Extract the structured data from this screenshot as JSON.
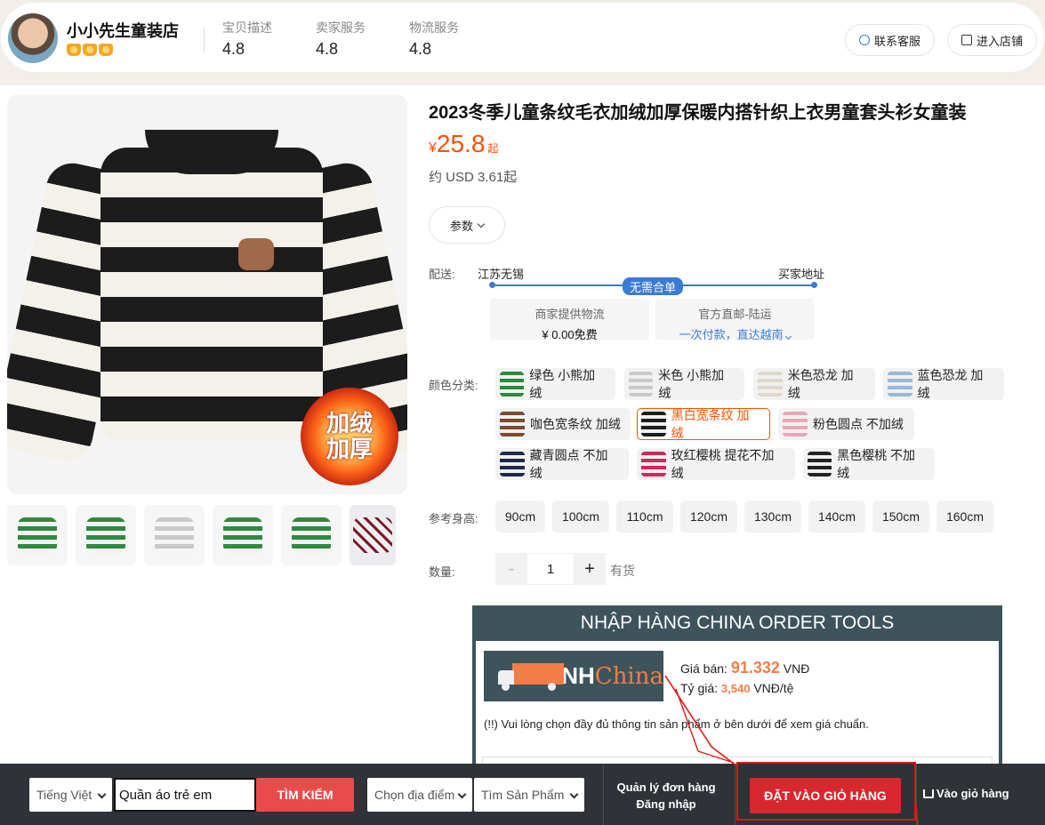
{
  "shop": {
    "name": "小小先生童装店",
    "ratings": [
      {
        "label": "宝贝描述",
        "value": "4.8"
      },
      {
        "label": "卖家服务",
        "value": "4.8"
      },
      {
        "label": "物流服务",
        "value": "4.8"
      }
    ],
    "contact_label": "联系客服",
    "enter_label": "进入店铺"
  },
  "product": {
    "title": "2023冬季儿童条纹毛衣加绒加厚保暖内搭针织上衣男童套头衫女童装",
    "price_currency": "¥",
    "price": "25.8",
    "price_suffix": "起",
    "usd_price": "约 USD 3.61起",
    "params_label": "参数",
    "badge_line1": "加绒",
    "badge_line2": "加厚"
  },
  "shipping": {
    "label": "配送:",
    "from": "江苏无锡",
    "to": "买家地址",
    "tag": "无需合单",
    "option1_title": "商家提供物流",
    "option1_value": "¥ 0.00免费",
    "option2_title": "官方直邮-陆运",
    "option2_value": "一次付款，直达越南"
  },
  "colors": {
    "label": "颜色分类:",
    "options": [
      {
        "label": "绿色 小熊加绒",
        "swatch": "#2e8a3e",
        "selected": false
      },
      {
        "label": "米色 小熊加绒",
        "swatch": "#c9c9c9",
        "selected": false
      },
      {
        "label": "米色恐龙 加绒",
        "swatch": "#e0d8c8",
        "selected": false
      },
      {
        "label": "蓝色恐龙 加绒",
        "swatch": "#9bb8d6",
        "selected": false
      },
      {
        "label": "咖色宽条纹 加绒",
        "swatch": "#7a4a34",
        "selected": false
      },
      {
        "label": "黑白宽条纹 加绒",
        "swatch": "#1c1c1c",
        "selected": true
      },
      {
        "label": "粉色圆点 不加绒",
        "swatch": "#e8a6b8",
        "selected": false
      },
      {
        "label": "藏青圆点 不加绒",
        "swatch": "#1e2a4a",
        "selected": false
      },
      {
        "label": "玫红樱桃 提花不加绒",
        "swatch": "#d0285c",
        "selected": false
      },
      {
        "label": "黑色樱桃 不加绒",
        "swatch": "#222222",
        "selected": false
      }
    ]
  },
  "sizes": {
    "label": "参考身高:",
    "options": [
      "90cm",
      "100cm",
      "110cm",
      "120cm",
      "130cm",
      "140cm",
      "150cm",
      "160cm"
    ]
  },
  "quantity": {
    "label": "数量:",
    "minus": "-",
    "value": "1",
    "plus": "+",
    "stock": "有货"
  },
  "tool": {
    "header": "NHẬP HÀNG CHINA ORDER TOOLS",
    "logo_nh": "NH",
    "logo_china": "China",
    "price_label": "Giá bán:",
    "price_value": "91.332",
    "price_unit": "VNĐ",
    "rate_label": "Tỷ giá:",
    "rate_value": "3,540",
    "rate_unit": "VNĐ/tệ",
    "note": "(!!) Vui lòng chọn đầy đủ thông tin sản phẩm ở bên dưới để xem giá chuẩn."
  },
  "bottom_bar": {
    "language": "Tiếng Việt",
    "search_value": "Quần áo trẻ em",
    "search_button": "TÌM KIẾM",
    "location": "Chọn địa điểm",
    "product_select": "Tìm Sản Phẩm",
    "order_mgmt": "Quản lý đơn hàng",
    "login": "Đăng nhập",
    "add_to_cart": "ĐẶT VÀO GIỎ HÀNG",
    "goto_cart": "Vào giỏ hàng"
  },
  "colors_theme": {
    "accent": "#ff5000",
    "blue": "#3a7bd5",
    "tool_bg": "#3d545c",
    "cart_red": "#d9272e",
    "annotation": "#e01515"
  }
}
